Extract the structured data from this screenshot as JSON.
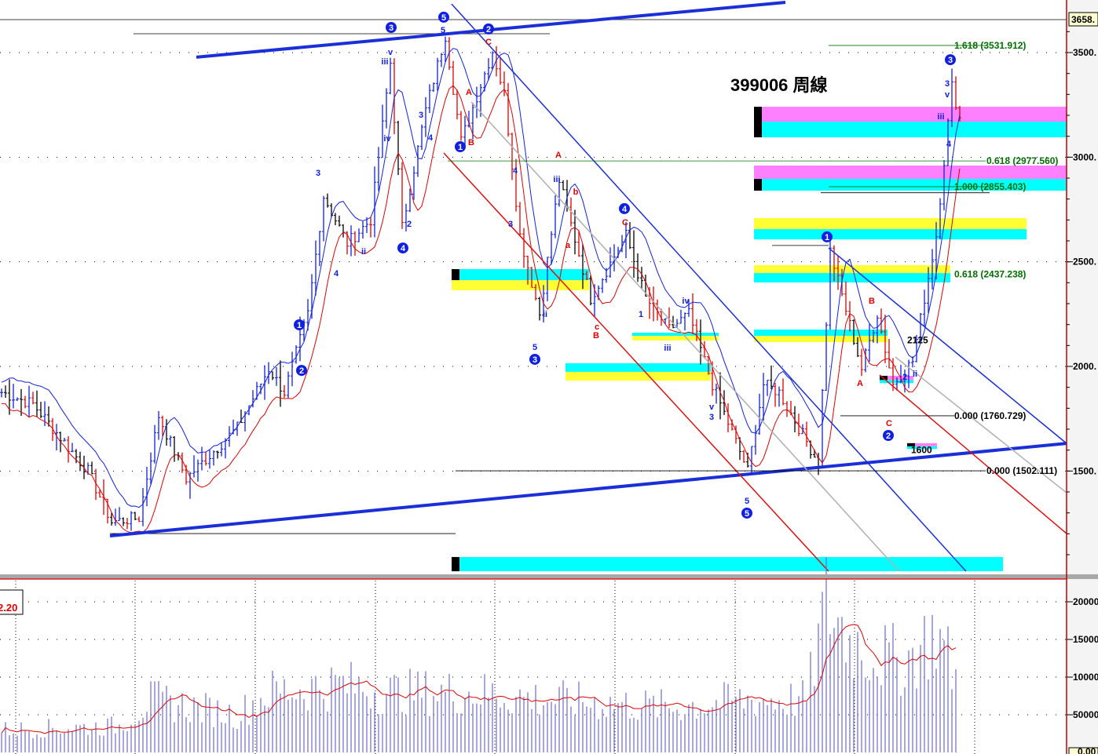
{
  "chart_data": {
    "type": "ohlc-candlestick",
    "title": "399006 周線",
    "price_axis": {
      "ticks": [
        1500,
        2000,
        2500,
        3000,
        3500
      ],
      "tick_labels": [
        "1500.",
        "2000.",
        "2500.",
        "3000.",
        "3500."
      ],
      "ylim": [
        1000,
        3750
      ],
      "current_marker": "3658."
    },
    "volume_axis": {
      "ticks": [
        5000,
        10000,
        15000,
        20000
      ],
      "tick_labels": [
        "50000",
        "10000",
        "15000",
        "20000"
      ],
      "ylim": [
        0,
        23000
      ],
      "bottom_label": "0.00",
      "indicator_label": "2.20"
    },
    "weeks_visible": 271.6,
    "price_pivots": [
      [
        0,
        1876
      ],
      [
        8,
        1820
      ],
      [
        22,
        1500
      ],
      [
        28,
        1257
      ],
      [
        35,
        1276
      ],
      [
        40,
        1764
      ],
      [
        47,
        1464
      ],
      [
        60,
        1707
      ],
      [
        68,
        1989
      ],
      [
        72,
        1876
      ],
      [
        78,
        2251
      ],
      [
        82,
        2814
      ],
      [
        88,
        2589
      ],
      [
        94,
        2701
      ],
      [
        99,
        3451
      ],
      [
        102,
        2664
      ],
      [
        108,
        3226
      ],
      [
        113,
        3582
      ],
      [
        117,
        3076
      ],
      [
        125,
        3507
      ],
      [
        128,
        3301
      ],
      [
        132,
        2626
      ],
      [
        137,
        2251
      ],
      [
        142,
        2889
      ],
      [
        150,
        2326
      ],
      [
        159,
        2626
      ],
      [
        164,
        2326
      ],
      [
        170,
        2176
      ],
      [
        175,
        2251
      ],
      [
        181,
        1914
      ],
      [
        190,
        1501
      ],
      [
        194,
        1914
      ],
      [
        198,
        1876
      ],
      [
        208,
        1539
      ],
      [
        211,
        2551
      ],
      [
        219,
        1989
      ],
      [
        223,
        2251
      ],
      [
        227,
        1914
      ],
      [
        232,
        2026
      ],
      [
        238,
        2626
      ],
      [
        242,
        3339
      ],
      [
        244,
        3189
      ]
    ],
    "volume_pivots": [
      [
        0,
        3000
      ],
      [
        30,
        3500
      ],
      [
        38,
        7000
      ],
      [
        60,
        5000
      ],
      [
        68,
        8000
      ],
      [
        86,
        9000
      ],
      [
        100,
        8000
      ],
      [
        120,
        8000
      ],
      [
        140,
        7000
      ],
      [
        170,
        6000
      ],
      [
        190,
        7000
      ],
      [
        205,
        7000
      ],
      [
        210,
        20000
      ],
      [
        216,
        15000
      ],
      [
        222,
        13000
      ],
      [
        230,
        12000
      ],
      [
        238,
        16000
      ],
      [
        244,
        9000
      ]
    ],
    "fib_labels": [
      {
        "text": "1.618 (3531.912)",
        "price": 3534,
        "week_start": 211,
        "week_end": 251,
        "color": "green"
      },
      {
        "text": "0.618 (2977.560)",
        "price": 2982,
        "week_start": 114,
        "week_end": 251,
        "color": "green"
      },
      {
        "text": "1.000 (2855.403)",
        "price": 2859,
        "week_start": 211,
        "week_end": 252,
        "color": "green"
      },
      {
        "text": "0.618 (2437.238)",
        "price": 2440,
        "week_start": 0,
        "week_end": 0,
        "color": "green"
      },
      {
        "text": "0.000 (1760.729)",
        "price": 1764,
        "week_start": 214,
        "week_end": 243,
        "color": "black"
      },
      {
        "text": "0.000 (1502.111)",
        "price": 1501,
        "week_start": 116,
        "week_end": 251,
        "color": "black"
      }
    ],
    "price_notes": [
      {
        "text": "2125",
        "week": 231,
        "price": 2125
      },
      {
        "text": "1600",
        "week": 232,
        "price": 1600
      }
    ],
    "horizontal_lines": [
      [
        34,
        140,
        3590
      ],
      [
        28,
        116,
        1201
      ],
      [
        196.6,
        211,
        2578
      ],
      [
        209,
        252,
        2830
      ]
    ],
    "trendlines": [
      {
        "from": [
          50,
          3478
        ],
        "to": [
          200,
          3740
        ],
        "color": "#1a2fd8",
        "width": 4
      },
      {
        "from": [
          28,
          1190
        ],
        "to": [
          271.6,
          1632
        ],
        "color": "#1a2fd8",
        "width": 4
      },
      {
        "from": [
          115,
          3732
        ],
        "to": [
          246,
          1021
        ],
        "color": "#1a2fd8",
        "width": 1.5
      },
      {
        "from": [
          211,
          2566
        ],
        "to": [
          271.6,
          1632
        ],
        "color": "#1a2fd8",
        "width": 1.5
      },
      {
        "from": [
          113,
          3020
        ],
        "to": [
          211,
          1021
        ],
        "color": "#e01010",
        "width": 1.5
      },
      {
        "from": [
          224,
          1959
        ],
        "to": [
          271.6,
          1201
        ],
        "color": "#e01010",
        "width": 1.5
      },
      {
        "from": [
          120,
          3264
        ],
        "to": [
          229,
          1021
        ],
        "color": "#b0b0b0",
        "width": 1.5
      },
      {
        "from": [
          228,
          2045
        ],
        "to": [
          271.6,
          1396
        ],
        "color": "#b0b0b0",
        "width": 1.5
      }
    ],
    "bands": [
      {
        "w0": 192,
        "w1": 271.6,
        "top": 3241,
        "bottom": 3170,
        "color": "magenta",
        "marker": true
      },
      {
        "w0": 192,
        "w1": 271.6,
        "top": 3170,
        "bottom": 3095,
        "color": "cyan",
        "marker": true
      },
      {
        "w0": 192,
        "w1": 271.6,
        "top": 2960,
        "bottom": 2896,
        "color": "magenta",
        "marker": false
      },
      {
        "w0": 192,
        "w1": 271.6,
        "top": 2896,
        "bottom": 2840,
        "color": "cyan",
        "marker": true
      },
      {
        "w0": 192,
        "w1": 261.4,
        "top": 2709,
        "bottom": 2656,
        "color": "yellow",
        "marker": false
      },
      {
        "w0": 192,
        "w1": 261.4,
        "top": 2656,
        "bottom": 2607,
        "color": "cyan",
        "marker": false
      },
      {
        "w0": 192,
        "w1": 242,
        "top": 2484,
        "bottom": 2446,
        "color": "yellow",
        "marker": false
      },
      {
        "w0": 192,
        "w1": 242,
        "top": 2446,
        "bottom": 2401,
        "color": "cyan",
        "marker": false
      },
      {
        "w0": 115,
        "w1": 150,
        "top": 2465,
        "bottom": 2412,
        "color": "cyan",
        "marker": true
      },
      {
        "w0": 115,
        "w1": 150,
        "top": 2412,
        "bottom": 2364,
        "color": "yellow",
        "marker": false
      },
      {
        "w0": 192,
        "w1": 226,
        "top": 2176,
        "bottom": 2146,
        "color": "cyan",
        "marker": false
      },
      {
        "w0": 192,
        "w1": 226,
        "top": 2146,
        "bottom": 2116,
        "color": "yellow",
        "marker": false
      },
      {
        "w0": 161,
        "w1": 183,
        "top": 2161,
        "bottom": 2146,
        "color": "cyan",
        "marker": false
      },
      {
        "w0": 161,
        "w1": 183,
        "top": 2146,
        "bottom": 2124,
        "color": "yellow",
        "marker": false
      },
      {
        "w0": 144,
        "w1": 181,
        "top": 2015,
        "bottom": 1974,
        "color": "cyan",
        "marker": false
      },
      {
        "w0": 144,
        "w1": 181,
        "top": 1974,
        "bottom": 1932,
        "color": "yellow",
        "marker": false
      },
      {
        "w0": 115,
        "w1": 255.4,
        "top": 1089,
        "bottom": 1021,
        "color": "cyan",
        "marker": true
      },
      {
        "w0": 224,
        "w1": 232.6,
        "top": 1955,
        "bottom": 1935,
        "color": "magenta",
        "marker": true
      },
      {
        "w0": 224,
        "w1": 232.6,
        "top": 1935,
        "bottom": 1920,
        "color": "cyan",
        "marker": false
      },
      {
        "w0": 231,
        "w1": 238.6,
        "top": 1633,
        "bottom": 1618,
        "color": "magenta",
        "marker": true
      },
      {
        "w0": 231,
        "w1": 238.6,
        "top": 1618,
        "bottom": 1605,
        "color": "cyan",
        "marker": false
      }
    ],
    "band_colors": {
      "magenta": "#ff80ff",
      "cyan": "#00ffff",
      "yellow": "#ffff33"
    },
    "wave_labels": [
      [
        99.6,
        3620,
        "3",
        "b",
        1
      ],
      [
        113,
        3669,
        "5",
        "b",
        1
      ],
      [
        124.4,
        3613,
        "2",
        "b",
        1
      ],
      [
        124.4,
        3553,
        "C",
        "r",
        0
      ],
      [
        117.2,
        3050,
        "1",
        "b",
        1
      ],
      [
        120,
        3073,
        "B",
        "r",
        0
      ],
      [
        119.4,
        3313,
        "A",
        "r",
        0
      ],
      [
        102.6,
        2566,
        "4",
        "b",
        1
      ],
      [
        76.8,
        1981,
        "2",
        "b",
        1
      ],
      [
        76.2,
        2199,
        "1",
        "b",
        1
      ],
      [
        136.2,
        2034,
        "3",
        "b",
        1
      ],
      [
        159,
        2754,
        "4",
        "b",
        1
      ],
      [
        159.2,
        2690,
        "C",
        "r",
        0
      ],
      [
        142.2,
        3013,
        "A",
        "r",
        0
      ],
      [
        151.8,
        2150,
        "B",
        "r",
        0
      ],
      [
        190.2,
        1299,
        "5",
        "b",
        1
      ],
      [
        210.6,
        2619,
        "1",
        "b",
        1
      ],
      [
        226.2,
        1670,
        "2",
        "b",
        1
      ],
      [
        226.4,
        1730,
        "C",
        "r",
        0
      ],
      [
        219,
        1921,
        "A",
        "r",
        0
      ],
      [
        222,
        2315,
        "B",
        "r",
        0
      ],
      [
        242,
        3466,
        "3",
        "b",
        1
      ],
      [
        81,
        2926,
        "3",
        "b",
        0
      ],
      [
        85.6,
        2446,
        "4",
        "b",
        0
      ],
      [
        92.6,
        2551,
        "ii",
        "b",
        0
      ],
      [
        98,
        3459,
        "iii",
        "b",
        0
      ],
      [
        98.6,
        3091,
        "iv",
        "b",
        0
      ],
      [
        99.4,
        3504,
        "v",
        "b",
        0
      ],
      [
        112.8,
        3609,
        "5",
        "b",
        0
      ],
      [
        104.2,
        2683,
        "2",
        "b",
        0
      ],
      [
        107.2,
        3204,
        "3",
        "b",
        0
      ],
      [
        109.6,
        3095,
        "4",
        "b",
        0
      ],
      [
        131.2,
        2938,
        "4",
        "b",
        0
      ],
      [
        130,
        2683,
        "3",
        "b",
        0
      ],
      [
        136.2,
        2094,
        "5",
        "b",
        0
      ],
      [
        141.8,
        2896,
        "iii",
        "b",
        0
      ],
      [
        138.8,
        2251,
        "ii",
        "b",
        0
      ],
      [
        146.6,
        2836,
        "b",
        "r",
        0
      ],
      [
        144.6,
        2581,
        "a",
        "r",
        0
      ],
      [
        152,
        2191,
        "c",
        "r",
        0
      ],
      [
        163.2,
        2251,
        "1",
        "b",
        0
      ],
      [
        174.6,
        2315,
        "iv",
        "b",
        0
      ],
      [
        170,
        2090,
        "iii",
        "b",
        0
      ],
      [
        181.2,
        1809,
        "v",
        "b",
        0
      ],
      [
        181.2,
        1760,
        "3",
        "b",
        0
      ],
      [
        190.2,
        1359,
        "5",
        "b",
        0
      ],
      [
        241.2,
        3354,
        "3",
        "b",
        0
      ],
      [
        241.2,
        3301,
        "v",
        "b",
        0
      ],
      [
        239.6,
        3196,
        "iii",
        "b",
        0
      ],
      [
        241.6,
        3065,
        "4",
        "b",
        0
      ],
      [
        230.4,
        1951,
        "2",
        "b",
        0
      ],
      [
        233,
        1966,
        "ii",
        "b",
        0
      ]
    ]
  }
}
